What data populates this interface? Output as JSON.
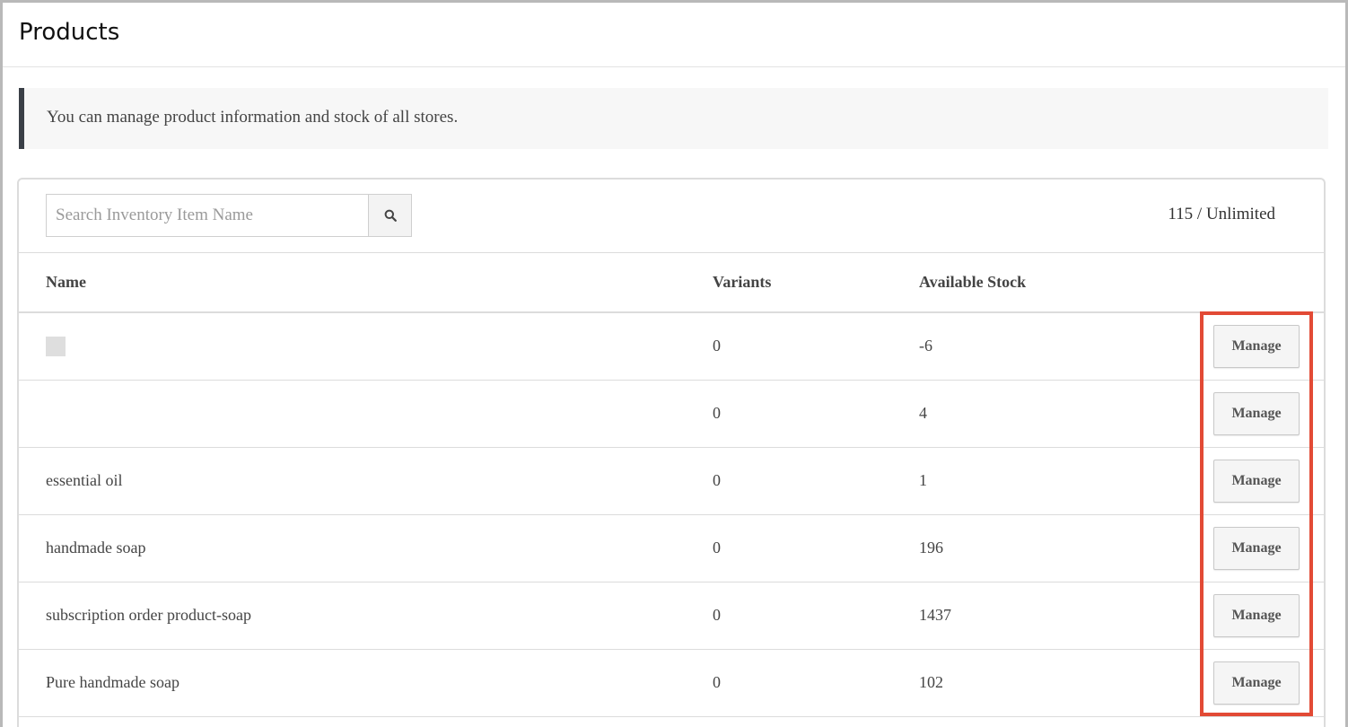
{
  "header": {
    "title": "Products"
  },
  "notice": {
    "text": "You can manage product information and stock of all stores."
  },
  "toolbar": {
    "search_placeholder": "Search Inventory Item Name",
    "search_icon": "search-icon",
    "quota": "115 / Unlimited"
  },
  "table": {
    "columns": {
      "name": "Name",
      "variants": "Variants",
      "stock": "Available Stock"
    },
    "rows": [
      {
        "name": "",
        "has_thumb": true,
        "variants": "0",
        "stock": "-6",
        "action": "Manage"
      },
      {
        "name": "",
        "has_thumb": false,
        "variants": "0",
        "stock": "4",
        "action": "Manage"
      },
      {
        "name": "essential oil",
        "has_thumb": false,
        "variants": "0",
        "stock": "1",
        "action": "Manage"
      },
      {
        "name": "handmade soap",
        "has_thumb": false,
        "variants": "0",
        "stock": "196",
        "action": "Manage"
      },
      {
        "name": "subscription order product-soap",
        "has_thumb": false,
        "variants": "0",
        "stock": "1437",
        "action": "Manage"
      },
      {
        "name": "Pure handmade soap",
        "has_thumb": false,
        "variants": "0",
        "stock": "102",
        "action": "Manage"
      }
    ]
  },
  "colors": {
    "highlight": "#e24a35",
    "notice_accent": "#3a3f47"
  }
}
